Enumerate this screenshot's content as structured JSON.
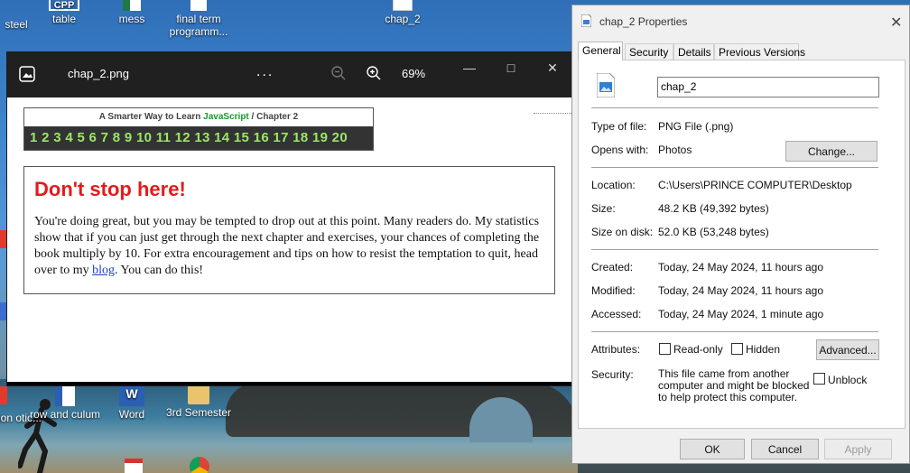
{
  "desktop": {
    "icons": [
      {
        "label": "steel"
      },
      {
        "label": "table",
        "badge": "CPP"
      },
      {
        "label": "mess"
      },
      {
        "label": "final term programm..."
      },
      {
        "label": "chap_2"
      },
      {
        "label": "row and culum"
      },
      {
        "label": "Word"
      },
      {
        "label": "3rd Semester"
      },
      {
        "label": "action otic..."
      }
    ]
  },
  "photos": {
    "filename": "chap_2.png",
    "more": "...",
    "zoom": "69%",
    "banner": {
      "prefix": "A Smarter Way to Learn ",
      "js": "JavaScript",
      "suffix": " / Chapter 2",
      "numbers": "1 2 3 4 5 6 7 8 9 10 11 12 13 14 15 16 17 18 19 20"
    },
    "message": {
      "title": "Don't stop here!",
      "body_1": "You're doing great, but you may be tempted to drop out at this point. Many readers do. My statistics show that if you can just get through the next chapter and exercises, your chances of completing the book multiply by 10. For extra encouragement and tips on how to resist the temptation to quit, head over to my ",
      "link": "blog",
      "body_2": ". You can do this!"
    }
  },
  "properties": {
    "title": "chap_2 Properties",
    "tabs": [
      "General",
      "Security",
      "Details",
      "Previous Versions"
    ],
    "file_name": "chap_2",
    "type_label": "Type of file:",
    "type_value": "PNG File (.png)",
    "opens_label": "Opens with:",
    "opens_value": "Photos",
    "change_btn": "Change...",
    "location_label": "Location:",
    "location_value": "C:\\Users\\PRINCE COMPUTER\\Desktop",
    "size_label": "Size:",
    "size_value": "48.2 KB (49,392 bytes)",
    "disk_label": "Size on disk:",
    "disk_value": "52.0 KB (53,248 bytes)",
    "created_label": "Created:",
    "created_value": "Today, 24 May 2024, 11 hours ago",
    "modified_label": "Modified:",
    "modified_value": "Today, 24 May 2024, 11 hours ago",
    "accessed_label": "Accessed:",
    "accessed_value": "Today, 24 May 2024, 1 minute ago",
    "attributes_label": "Attributes:",
    "readonly": "Read-only",
    "hidden": "Hidden",
    "advanced_btn": "Advanced...",
    "security_label": "Security:",
    "security_text": "This file came from another computer and might be blocked to help protect this computer.",
    "unblock": "Unblock",
    "ok": "OK",
    "cancel": "Cancel",
    "apply": "Apply"
  }
}
